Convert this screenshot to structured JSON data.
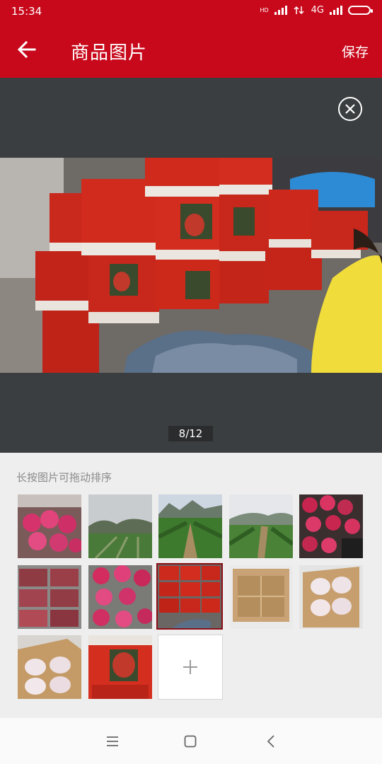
{
  "status": {
    "time": "15:34",
    "network": "4G",
    "hd": "HD"
  },
  "header": {
    "title": "商品图片",
    "save_label": "保存"
  },
  "viewer": {
    "counter": "8/12",
    "current_index": 8,
    "total": 12
  },
  "hint": "长按图片可拖动排序",
  "thumbnails": [
    {
      "name": "thumb-dragon-fruit-crate"
    },
    {
      "name": "thumb-field-hills"
    },
    {
      "name": "thumb-plantation-rows"
    },
    {
      "name": "thumb-plantation-hills"
    },
    {
      "name": "thumb-dragon-fruit-pile"
    },
    {
      "name": "thumb-fruit-crates-stack"
    },
    {
      "name": "thumb-dragon-fruit-basket"
    },
    {
      "name": "thumb-red-gift-boxes"
    },
    {
      "name": "thumb-empty-carton"
    },
    {
      "name": "thumb-packed-fruit-box"
    },
    {
      "name": "thumb-packed-fruit-carton"
    },
    {
      "name": "thumb-gift-box-closeup"
    }
  ],
  "colors": {
    "brand": "#c8091b",
    "viewer_bg": "#3b3e40",
    "selected_border": "#8a0f16"
  },
  "icons": {
    "back": "arrow-left-icon",
    "close": "close-circle-icon",
    "add": "plus-icon",
    "menu": "menu-icon",
    "home": "home-icon",
    "nav_back": "chevron-left-icon"
  }
}
